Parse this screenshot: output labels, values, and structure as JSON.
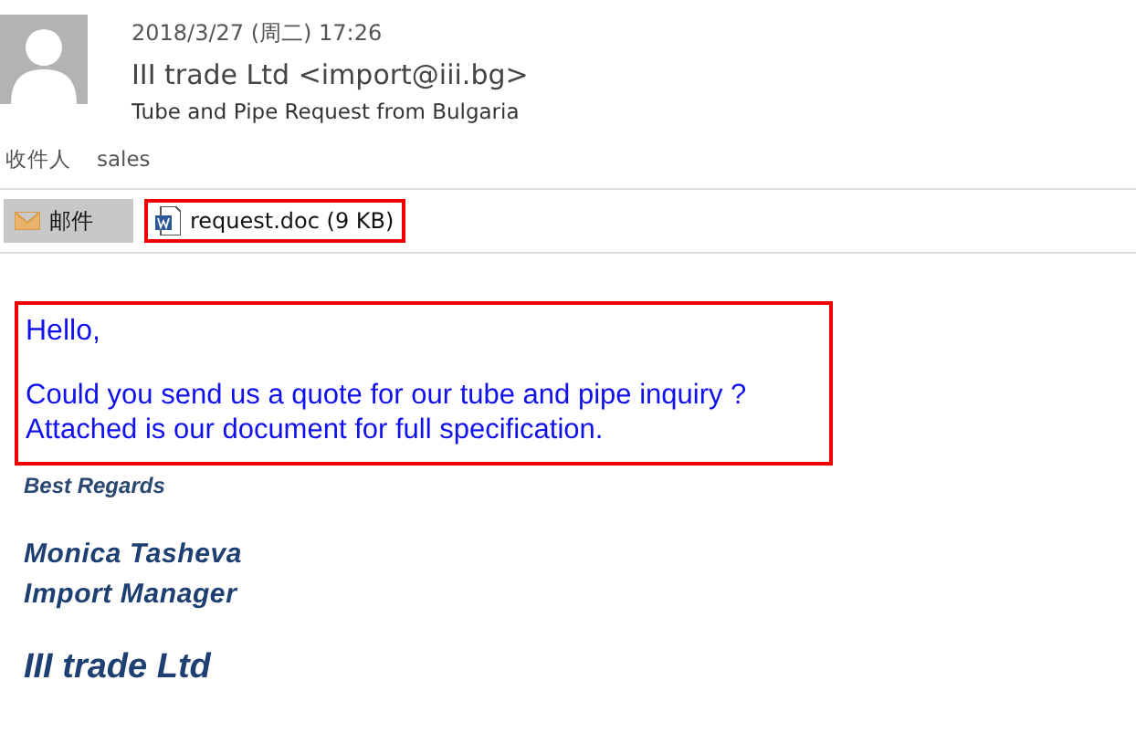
{
  "header": {
    "date": "2018/3/27 (周二) 17:26",
    "sender": "III trade Ltd <import@iii.bg>",
    "subject": "Tube and Pipe Request from Bulgaria",
    "recipient_label": "收件人",
    "recipient": "sales"
  },
  "tabs": [
    {
      "kind": "message",
      "label": "邮件",
      "selected": true
    },
    {
      "kind": "attachment",
      "label": "request.doc (9 KB)",
      "selected": false,
      "highlighted": true
    }
  ],
  "body": {
    "highlighted": true,
    "greeting": "Hello,",
    "lines": [
      "Could you send us a quote for our tube and pipe inquiry ?",
      "Attached is our document for full specification."
    ]
  },
  "signature": {
    "closing": "Best Regards",
    "name": "Monica Tasheva",
    "title": "Import Manager",
    "company": "III trade Ltd"
  }
}
